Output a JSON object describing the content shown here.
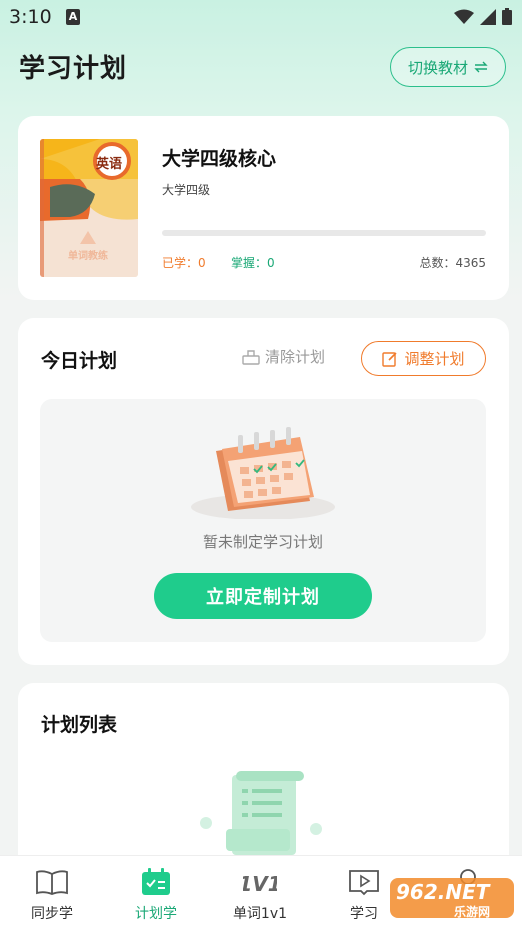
{
  "status_bar": {
    "time": "3:10",
    "notification_icon_letter": "A"
  },
  "header": {
    "title": "学习计划",
    "switch_button_label": "切换教材",
    "switch_icon": "swap-arrows-icon"
  },
  "book": {
    "cover_label": "英语",
    "cover_subtitle": "单词教练",
    "name": "大学四级核心",
    "level": "大学四级",
    "progress": 0,
    "learned": "已学：0",
    "mastered": "掌握：0",
    "total": "总数：4365"
  },
  "today_plan": {
    "title": "今日计划",
    "clear_label": "清除计划",
    "adjust_label": "调整计划",
    "empty_text": "暂未制定学习计划",
    "create_button_label": "立即定制计划"
  },
  "plan_list": {
    "title": "计划列表"
  },
  "tabs": [
    {
      "label": "同步学",
      "icon": "book-open-icon",
      "active": false
    },
    {
      "label": "计划学",
      "icon": "calendar-check-icon",
      "active": true
    },
    {
      "label": "单词1v1",
      "icon": "one-v-one-icon",
      "active": false
    },
    {
      "label": "学习",
      "icon": "video-book-icon",
      "active": false
    },
    {
      "label": "",
      "icon": "profile-icon",
      "active": false
    }
  ],
  "watermark": {
    "text": "962.NET",
    "subtext": "乐游网"
  },
  "colors": {
    "accent": "#1fcc8c",
    "orange": "#f07b2c",
    "green_text": "#1aa876"
  }
}
